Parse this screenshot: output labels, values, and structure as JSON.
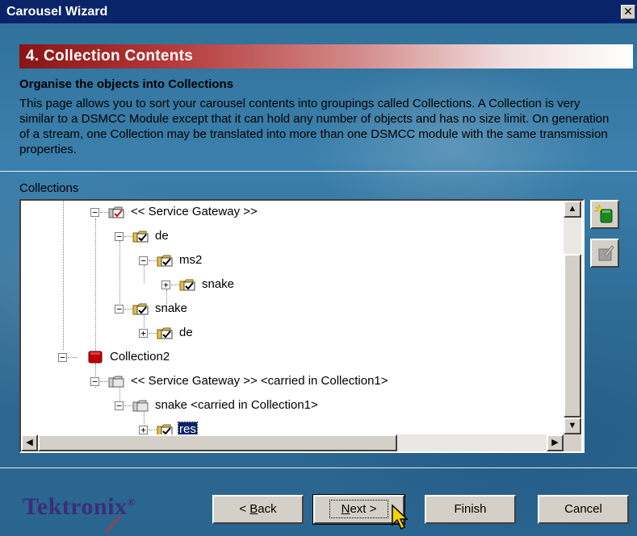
{
  "window": {
    "title": "Carousel Wizard",
    "close_glyph": "✕"
  },
  "step": {
    "title": "4. Collection Contents",
    "subtitle": "Organise the objects into Collections",
    "description": "This page allows you to sort your carousel contents into groupings called Collections. A Collection is very similar to a DSMCC Module except that it can hold any number of objects and has no size limit. On generation of a stream, one Collection may be translated into more than one DSMCC module with the same transmission properties."
  },
  "collections": {
    "label": "Collections",
    "tree": [
      {
        "label": "<< Service Gateway >>",
        "icon": "folder-checked-icon",
        "expander": "−"
      },
      {
        "label": "de",
        "icon": "folder-checked-icon",
        "expander": "−"
      },
      {
        "label": "ms2",
        "icon": "folder-checked-icon",
        "expander": "−"
      },
      {
        "label": "snake",
        "icon": "folder-checked-icon",
        "expander": "+"
      },
      {
        "label": "snake",
        "icon": "folder-checked-icon",
        "expander": "−"
      },
      {
        "label": "de",
        "icon": "folder-checked-icon",
        "expander": "+"
      },
      {
        "label": "Collection2",
        "icon": "collection-icon",
        "expander": "−"
      },
      {
        "label": "<< Service Gateway >> <carried in Collection1>",
        "icon": "folder-gray-icon",
        "expander": "−"
      },
      {
        "label": "snake <carried in Collection1>",
        "icon": "folder-gray-icon",
        "expander": "−"
      },
      {
        "label": "res",
        "icon": "folder-checked-icon",
        "expander": "+",
        "selected": true
      }
    ],
    "scroll_glyphs": {
      "up": "▲",
      "down": "▼",
      "left": "◀",
      "right": "▶"
    }
  },
  "side_buttons": {
    "new": "new-collection-icon",
    "edit": "edit-collection-icon"
  },
  "footer": {
    "logo_text": "Tektronix",
    "logo_mark": "®",
    "buttons": {
      "back_prefix": "< ",
      "back_accel": "B",
      "back_rest": "ack",
      "next_accel": "N",
      "next_rest": "ext >",
      "finish": "Finish",
      "cancel": "Cancel"
    }
  },
  "colors": {
    "title_bar": "#0a246a",
    "header_band": "#8a1414",
    "background": "#2e6f98",
    "logo": "#3d2c7a",
    "selection": "#0a246a"
  }
}
